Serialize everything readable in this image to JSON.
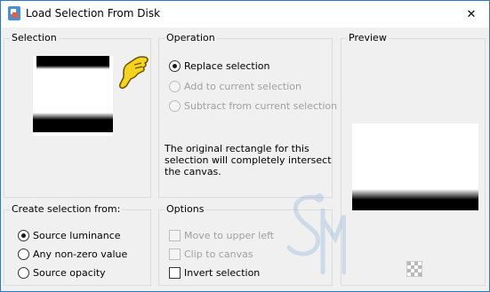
{
  "window": {
    "title": "Load Selection From Disk",
    "close_glyph": "✕"
  },
  "selection": {
    "title": "Selection"
  },
  "operation": {
    "title": "Operation",
    "options": [
      {
        "label": "Replace selection",
        "checked": true,
        "enabled": true
      },
      {
        "label": "Add to current selection",
        "checked": false,
        "enabled": false
      },
      {
        "label": "Subtract from current selection",
        "checked": false,
        "enabled": false
      }
    ],
    "description": [
      "The original rectangle for this",
      "selection will completely intersect",
      "the canvas."
    ]
  },
  "preview": {
    "title": "Preview"
  },
  "create_from": {
    "title": "Create selection from:",
    "options": [
      {
        "label": "Source luminance",
        "checked": true
      },
      {
        "label": "Any non-zero value",
        "checked": false
      },
      {
        "label": "Source opacity",
        "checked": false
      }
    ]
  },
  "options": {
    "title": "Options",
    "items": [
      {
        "label": "Move to upper left",
        "checked": false,
        "enabled": false
      },
      {
        "label": "Clip to canvas",
        "checked": false,
        "enabled": false
      },
      {
        "label": "Invert selection",
        "checked": false,
        "enabled": true
      }
    ]
  },
  "colors": {
    "accent_border": "#2b79c2",
    "pointer_yellow": "#f6d31d",
    "watermark_blue": "#8fb4d9"
  },
  "icons": {
    "app": "app-icon",
    "close": "close-icon",
    "pointer": "pointing-hand-icon",
    "transparency": "transparency-toggle-icon"
  }
}
